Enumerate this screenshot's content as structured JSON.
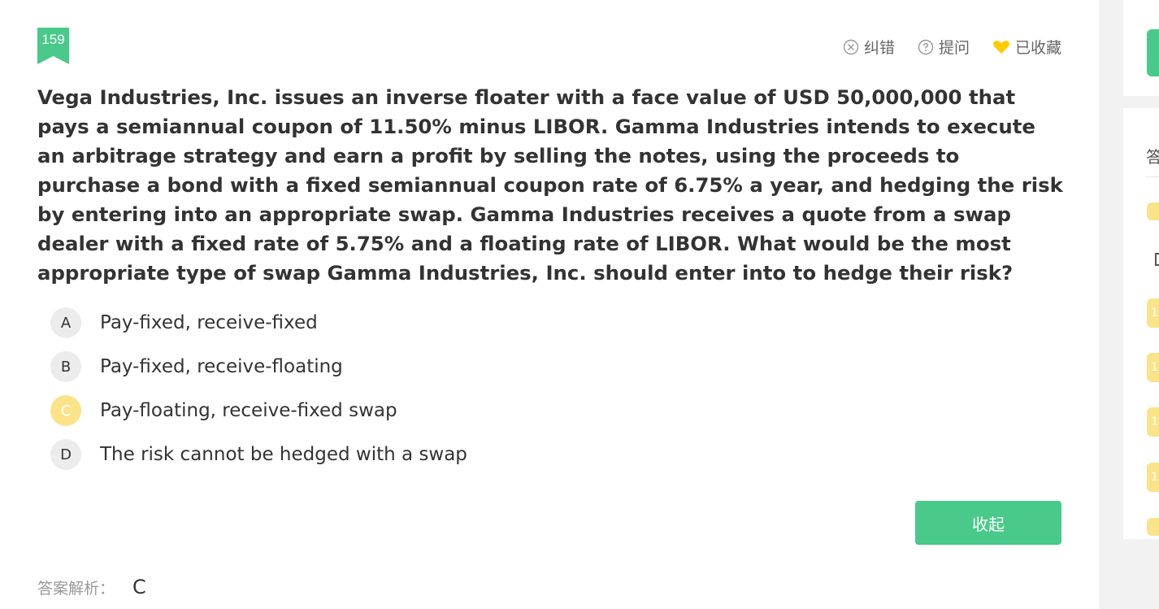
{
  "question": {
    "number": "159",
    "text": "Vega Industries, Inc. issues an inverse floater with a face value of USD 50,000,000 that pays a semiannual coupon of 11.50% minus LIBOR. Gamma Industries intends to execute an arbitrage strategy and earn a profit by selling the notes, using the proceeds to purchase a bond with a fixed semiannual coupon rate of 6.75% a year, and hedging the risk by entering into an appropriate swap. Gamma Industries receives a quote from a swap dealer with a fixed rate of 5.75% and a floating rate of LIBOR. What would be the most appropriate type of swap Gamma Industries, Inc. should enter into to hedge their risk?"
  },
  "toolbar": {
    "report_error": "纠错",
    "ask": "提问",
    "favorited": "已收藏"
  },
  "options": [
    {
      "letter": "A",
      "text": "Pay-fixed, receive-fixed"
    },
    {
      "letter": "B",
      "text": "Pay-fixed, receive-floating"
    },
    {
      "letter": "C",
      "text": "Pay-floating, receive-fixed swap",
      "correct": true
    },
    {
      "letter": "D",
      "text": "The risk cannot be hedged with a swap"
    }
  ],
  "collapse_button": "收起",
  "analysis": {
    "label": "答案解析：",
    "answer": "C"
  },
  "side_panel": {
    "title": "答",
    "chips": [
      "1",
      "1",
      "1",
      "1"
    ]
  },
  "colors": {
    "accent_green": "#49c98a",
    "correct_yellow": "#fbe38a",
    "heart_yellow": "#ffcc00"
  }
}
